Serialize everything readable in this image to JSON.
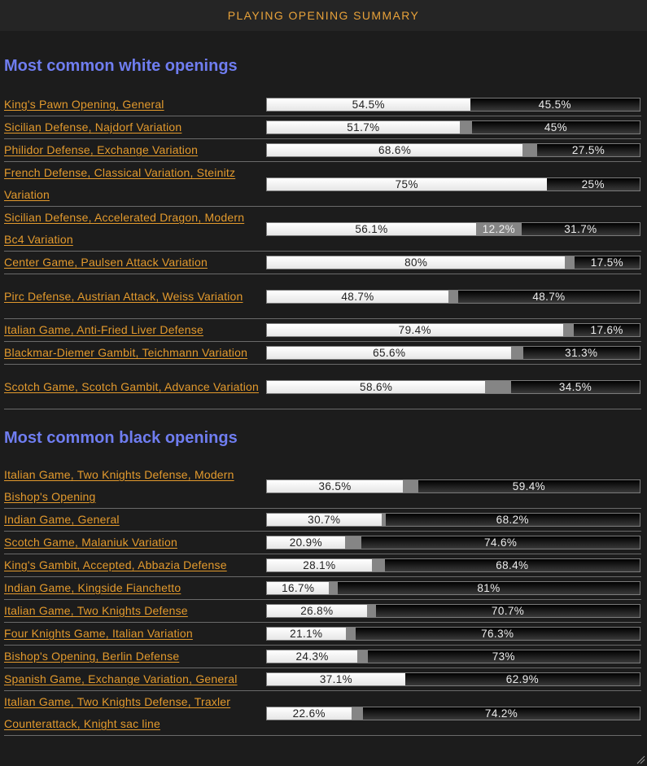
{
  "header": {
    "title": "PLAYING OPENING SUMMARY"
  },
  "colors": {
    "accent_title": "#e8a23a",
    "section_heading": "#6f7df0",
    "opening_link": "#e39a2d",
    "win_segment": "#f2f2f2",
    "draw_segment": "#858585",
    "loss_segment": "#1a1a1a"
  },
  "white_section": {
    "heading": "Most common white openings",
    "rows": [
      {
        "name": "King's Pawn Opening, General",
        "white": 54.5,
        "draw": 0,
        "black": 45.5,
        "labels": [
          "54.5%",
          "",
          "45.5%"
        ]
      },
      {
        "name": "Sicilian Defense, Najdorf Variation",
        "white": 51.7,
        "draw": 3.3,
        "black": 45,
        "labels": [
          "51.7%",
          "",
          "45%"
        ]
      },
      {
        "name": "Philidor Defense, Exchange Variation",
        "white": 68.6,
        "draw": 3.9,
        "black": 27.5,
        "labels": [
          "68.6%",
          "",
          "27.5%"
        ]
      },
      {
        "name": "French Defense, Classical Variation, Steinitz Variation",
        "white": 75,
        "draw": 0,
        "black": 25,
        "labels": [
          "75%",
          "",
          "25%"
        ]
      },
      {
        "name": "Sicilian Defense, Accelerated Dragon, Modern Bc4 Variation",
        "white": 56.1,
        "draw": 12.2,
        "black": 31.7,
        "labels": [
          "56.1%",
          "12.2%",
          "31.7%"
        ]
      },
      {
        "name": "Center Game, Paulsen Attack Variation",
        "white": 80,
        "draw": 2.5,
        "black": 17.5,
        "labels": [
          "80%",
          "",
          "17.5%"
        ]
      },
      {
        "name": "Pirc Defense, Austrian Attack, Weiss Variation",
        "white": 48.7,
        "draw": 2.6,
        "black": 48.7,
        "labels": [
          "48.7%",
          "",
          "48.7%"
        ]
      },
      {
        "name": "Italian Game, Anti-Fried Liver Defense",
        "white": 79.4,
        "draw": 3,
        "black": 17.6,
        "labels": [
          "79.4%",
          "",
          "17.6%"
        ]
      },
      {
        "name": "Blackmar-Diemer Gambit, Teichmann Variation",
        "white": 65.6,
        "draw": 3.1,
        "black": 31.3,
        "labels": [
          "65.6%",
          "",
          "31.3%"
        ]
      },
      {
        "name": "Scotch Game, Scotch Gambit, Advance Variation",
        "white": 58.6,
        "draw": 6.9,
        "black": 34.5,
        "labels": [
          "58.6%",
          "",
          "34.5%"
        ]
      }
    ]
  },
  "black_section": {
    "heading": "Most common black openings",
    "rows": [
      {
        "name": "Italian Game, Two Knights Defense, Modern Bishop's Opening",
        "white": 36.5,
        "draw": 4.1,
        "black": 59.4,
        "labels": [
          "36.5%",
          "",
          "59.4%"
        ]
      },
      {
        "name": "Indian Game, General",
        "white": 30.7,
        "draw": 1.1,
        "black": 68.2,
        "labels": [
          "30.7%",
          "",
          "68.2%"
        ]
      },
      {
        "name": "Scotch Game, Malaniuk Variation",
        "white": 20.9,
        "draw": 4.5,
        "black": 74.6,
        "labels": [
          "20.9%",
          "",
          "74.6%"
        ]
      },
      {
        "name": "King's Gambit, Accepted, Abbazia Defense",
        "white": 28.1,
        "draw": 3.5,
        "black": 68.4,
        "labels": [
          "28.1%",
          "",
          "68.4%"
        ]
      },
      {
        "name": "Indian Game, Kingside Fianchetto",
        "white": 16.7,
        "draw": 2.3,
        "black": 81,
        "labels": [
          "16.7%",
          "",
          "81%"
        ]
      },
      {
        "name": "Italian Game, Two Knights Defense",
        "white": 26.8,
        "draw": 2.5,
        "black": 70.7,
        "labels": [
          "26.8%",
          "",
          "70.7%"
        ]
      },
      {
        "name": "Four Knights Game, Italian Variation",
        "white": 21.1,
        "draw": 2.6,
        "black": 76.3,
        "labels": [
          "21.1%",
          "",
          "76.3%"
        ]
      },
      {
        "name": "Bishop's Opening, Berlin Defense",
        "white": 24.3,
        "draw": 2.7,
        "black": 73,
        "labels": [
          "24.3%",
          "",
          "73%"
        ]
      },
      {
        "name": "Spanish Game, Exchange Variation, General",
        "white": 37.1,
        "draw": 0,
        "black": 62.9,
        "labels": [
          "37.1%",
          "",
          "62.9%"
        ]
      },
      {
        "name": "Italian Game, Two Knights Defense, Traxler Counterattack, Knight sac line",
        "white": 22.6,
        "draw": 3.2,
        "black": 74.2,
        "labels": [
          "22.6%",
          "",
          "74.2%"
        ]
      }
    ]
  }
}
